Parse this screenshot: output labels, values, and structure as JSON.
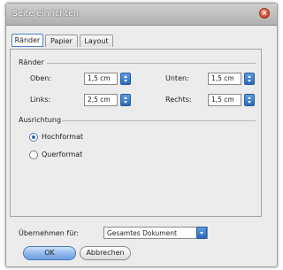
{
  "window": {
    "title": "Seite einrichten"
  },
  "tabs": [
    {
      "label": "Ränder",
      "active": true
    },
    {
      "label": "Papier",
      "active": false
    },
    {
      "label": "Layout",
      "active": false
    }
  ],
  "margins": {
    "group_label": "Ränder",
    "top_label": "Oben:",
    "top_value": "1,5 cm",
    "bottom_label": "Unten:",
    "bottom_value": "1,5 cm",
    "left_label": "Links:",
    "left_value": "2,5 cm",
    "right_label": "Rechts:",
    "right_value": "1,5 cm"
  },
  "orientation": {
    "group_label": "Ausrichtung",
    "portrait_label": "Hochformat",
    "landscape_label": "Querformat",
    "selected": "portrait"
  },
  "apply_to": {
    "label": "Übernehmen für:",
    "value": "Gesamtes Dokument"
  },
  "buttons": {
    "ok": "OK",
    "cancel": "Abbrechen"
  },
  "colors": {
    "accent": "#3568b6",
    "close": "#c9432a"
  }
}
